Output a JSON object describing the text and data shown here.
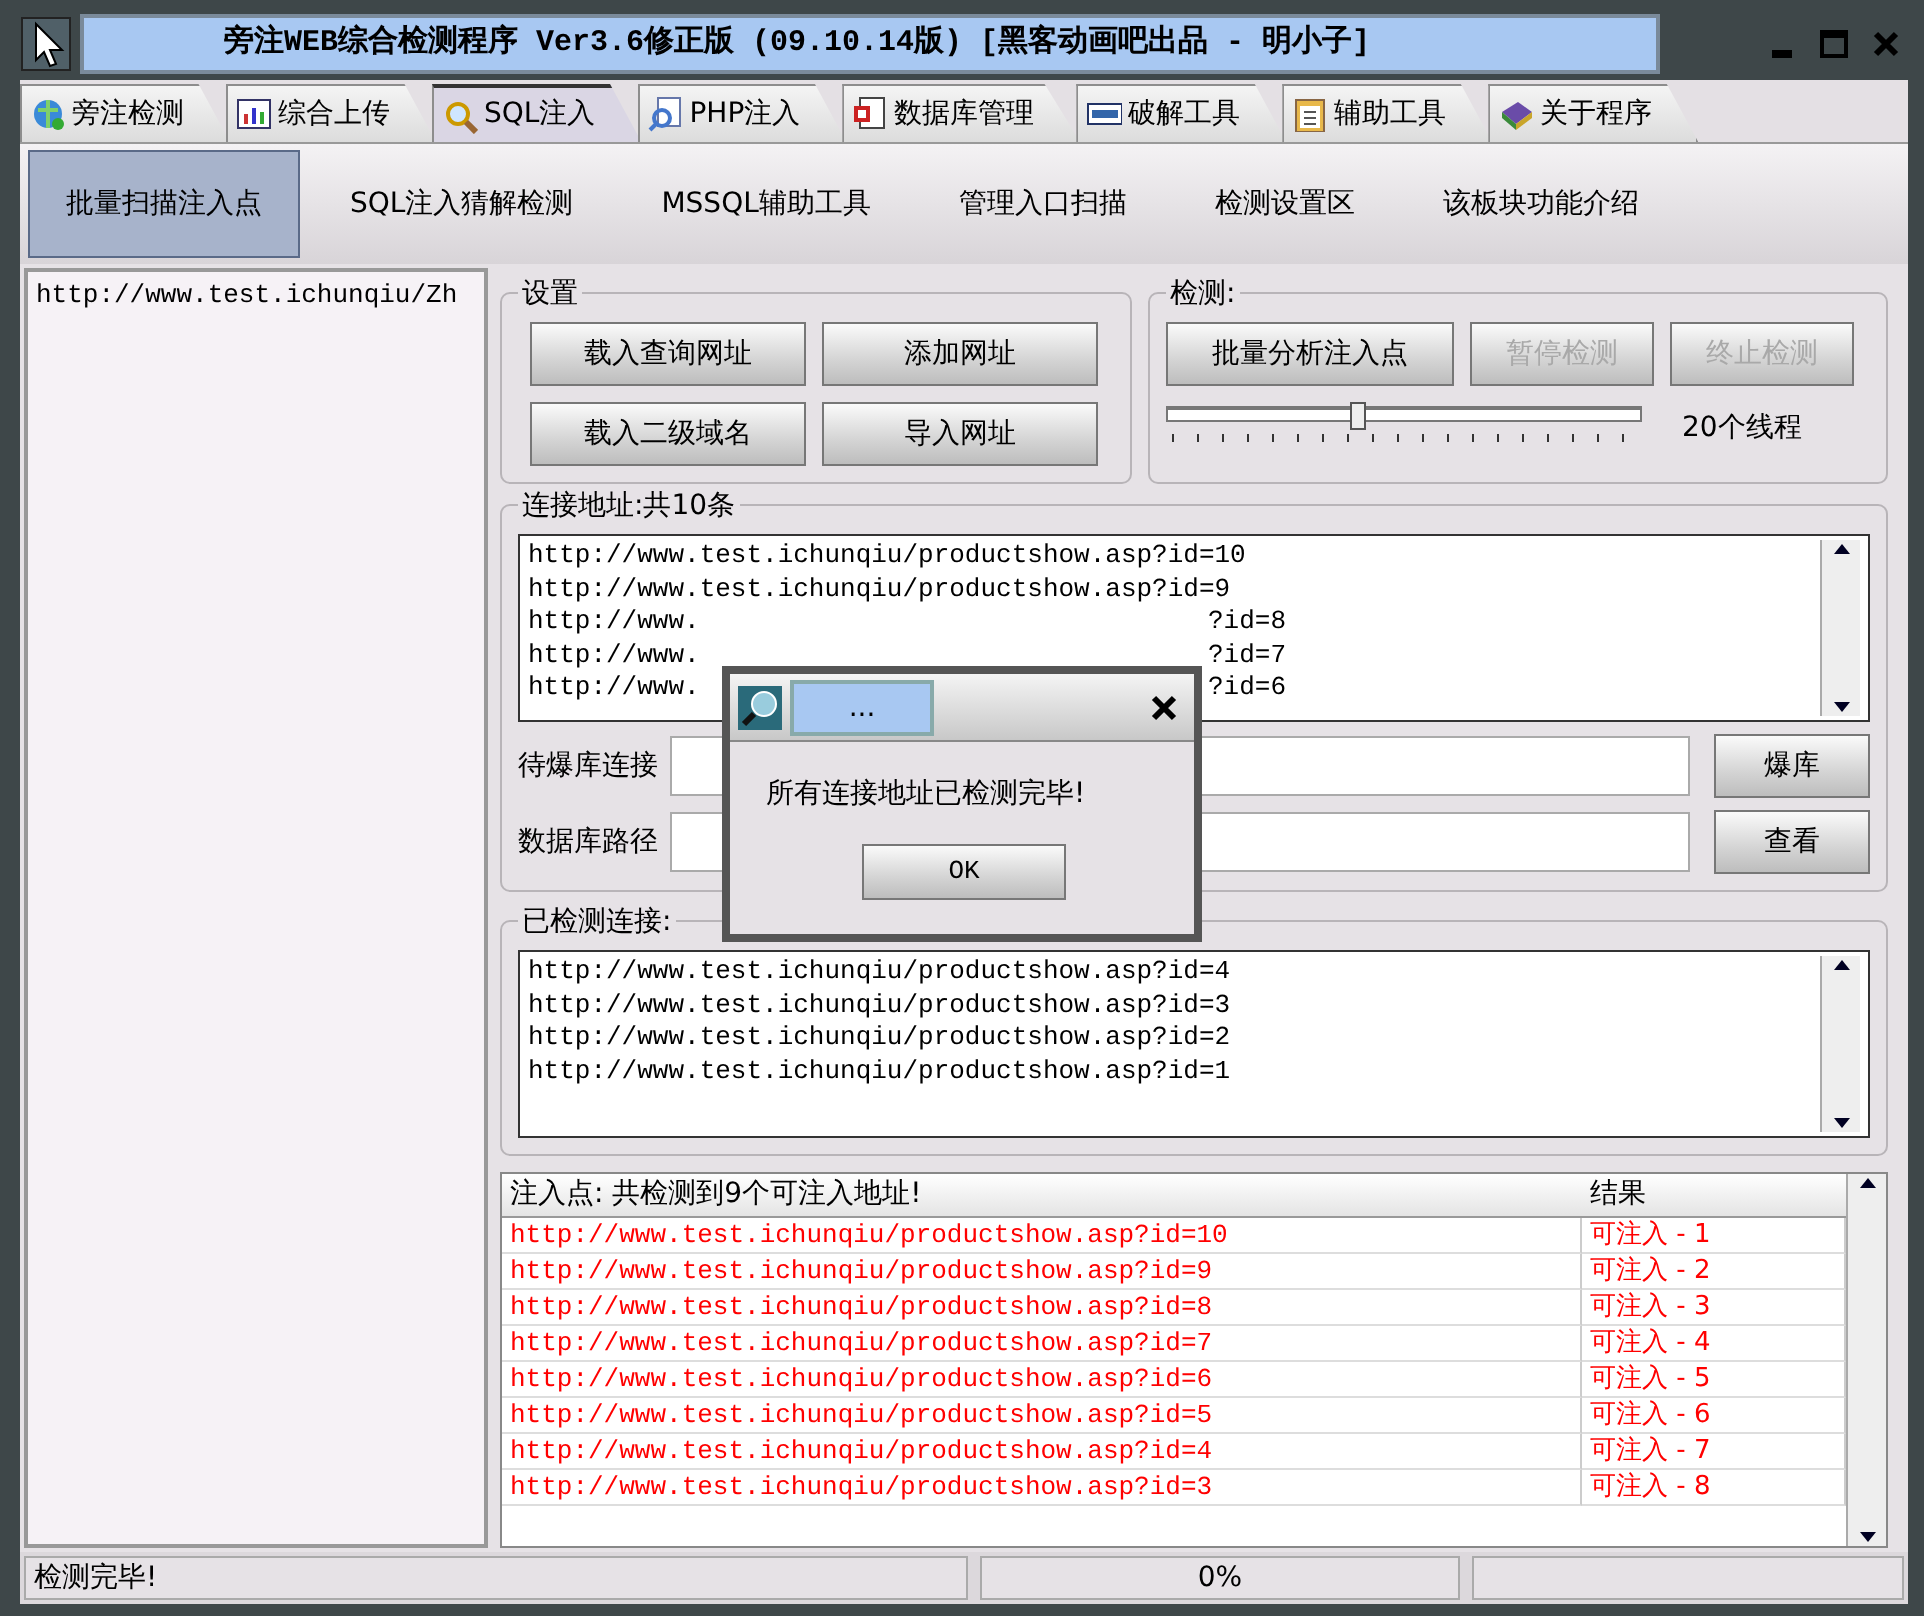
{
  "window": {
    "title": "旁注WEB综合检测程序 Ver3.6修正版 (09.10.14版) [黑客动画吧出品 - 明小子]"
  },
  "tabs": [
    {
      "label": "旁注检测",
      "selected": false
    },
    {
      "label": "综合上传",
      "selected": false
    },
    {
      "label": "SQL注入",
      "selected": true
    },
    {
      "label": "PHP注入",
      "selected": false
    },
    {
      "label": "数据库管理",
      "selected": false
    },
    {
      "label": "破解工具",
      "selected": false
    },
    {
      "label": "辅助工具",
      "selected": false
    },
    {
      "label": "关于程序",
      "selected": false
    }
  ],
  "subtabs": [
    {
      "label": "批量扫描注入点",
      "selected": true
    },
    {
      "label": "SQL注入猜解检测",
      "selected": false
    },
    {
      "label": "MSSQL辅助工具",
      "selected": false
    },
    {
      "label": "管理入口扫描",
      "selected": false
    },
    {
      "label": "检测设置区",
      "selected": false
    },
    {
      "label": "该板块功能介绍",
      "selected": false
    }
  ],
  "sidebar": {
    "items": [
      "http://www.test.ichunqiu/Zh"
    ]
  },
  "settings": {
    "title": "设置",
    "buttons": [
      "载入查询网址",
      "添加网址",
      "载入二级域名",
      "导入网址"
    ]
  },
  "detect": {
    "title": "检测:",
    "buttons": [
      {
        "label": "批量分析注入点",
        "disabled": false
      },
      {
        "label": "暂停检测",
        "disabled": true
      },
      {
        "label": "终止检测",
        "disabled": true
      }
    ],
    "threads": {
      "level": 0.4,
      "reading": "20个线程"
    }
  },
  "connections": {
    "title": "连接地址:共10条",
    "items": [
      {
        "kind": "full",
        "text": "http://www.test.ichunqiu/productshow.asp?id=10"
      },
      {
        "kind": "full",
        "text": "http://www.test.ichunqiu/productshow.asp?id=9"
      },
      {
        "kind": "covered",
        "start": "http://www.",
        "end": "?id=8"
      },
      {
        "kind": "covered",
        "start": "http://www.",
        "end": "?id=7"
      },
      {
        "kind": "covered",
        "start": "http://www.",
        "end": "?id=6"
      }
    ],
    "fields": [
      {
        "label": "待爆库连接",
        "button": "爆库"
      },
      {
        "label": "数据库路径",
        "button": "查看"
      }
    ]
  },
  "checked": {
    "title": "已检测连接:",
    "items": [
      "http://www.test.ichunqiu/productshow.asp?id=4",
      "http://www.test.ichunqiu/productshow.asp?id=3",
      "http://www.test.ichunqiu/productshow.asp?id=2",
      "http://www.test.ichunqiu/productshow.asp?id=1"
    ]
  },
  "table": {
    "columns": [
      "注入点: 共检测到9个可注入地址!",
      "结果"
    ],
    "rows": [
      [
        "http://www.test.ichunqiu/productshow.asp?id=10",
        "可注入 - 1"
      ],
      [
        "http://www.test.ichunqiu/productshow.asp?id=9",
        "可注入 - 2"
      ],
      [
        "http://www.test.ichunqiu/productshow.asp?id=8",
        "可注入 - 3"
      ],
      [
        "http://www.test.ichunqiu/productshow.asp?id=7",
        "可注入 - 4"
      ],
      [
        "http://www.test.ichunqiu/productshow.asp?id=6",
        "可注入 - 5"
      ],
      [
        "http://www.test.ichunqiu/productshow.asp?id=5",
        "可注入 - 6"
      ],
      [
        "http://www.test.ichunqiu/productshow.asp?id=4",
        "可注入 - 7"
      ],
      [
        "http://www.test.ichunqiu/productshow.asp?id=3",
        "可注入 - 8"
      ]
    ]
  },
  "status_bar": {
    "message": "检测完毕!",
    "progress": {
      "level": 0,
      "reading": "0%"
    }
  },
  "dialog": {
    "title": "...",
    "message": "所有连接地址已检测完毕!",
    "button": "OK"
  }
}
